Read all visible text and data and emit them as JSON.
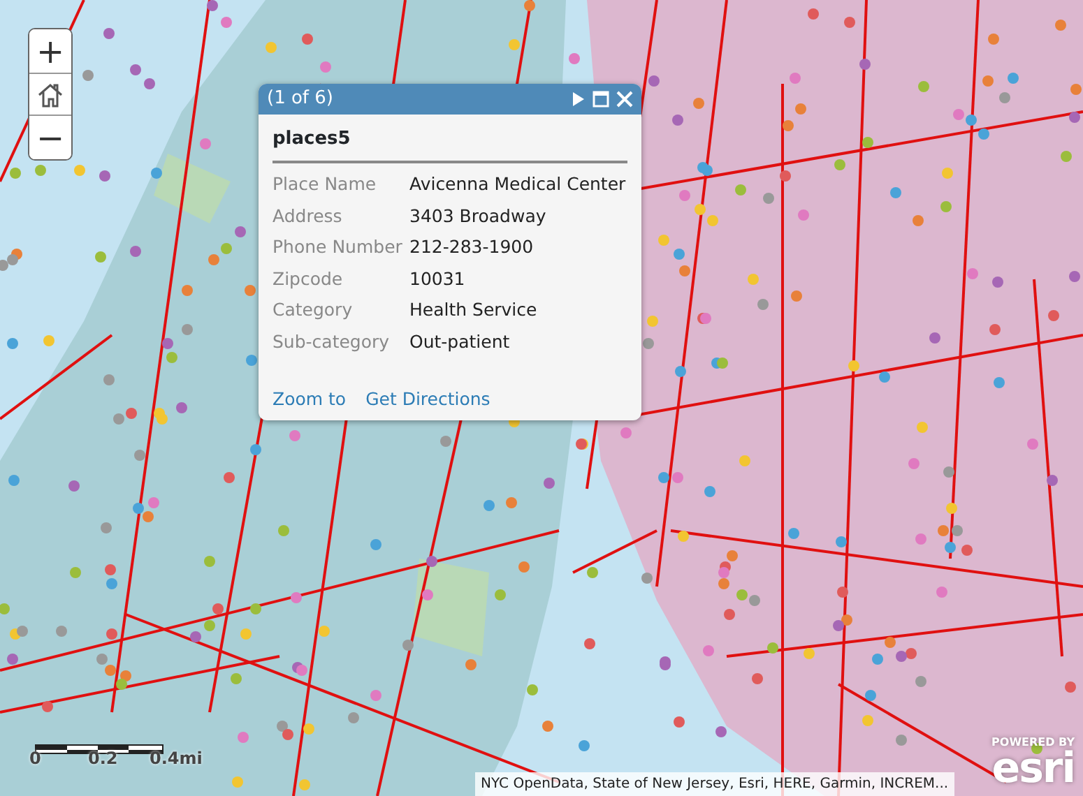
{
  "zoom_controls": {
    "zoom_in": "+",
    "zoom_out": "−"
  },
  "popup": {
    "counter": "(1 of 6)",
    "title": "places5",
    "fields": [
      {
        "label": "Place Name",
        "value": "Avicenna Medical Center"
      },
      {
        "label": "Address",
        "value": "3403 Broadway"
      },
      {
        "label": "Phone Number",
        "value": "212-283-1900"
      },
      {
        "label": "Zipcode",
        "value": "10031"
      },
      {
        "label": "Category",
        "value": "Health Service"
      },
      {
        "label": "Sub-category",
        "value": "Out-patient"
      }
    ],
    "actions": [
      "Zoom to",
      "Get Directions"
    ]
  },
  "scale_bar": {
    "labels": [
      "0",
      "0.2",
      "0.4mi"
    ]
  },
  "attribution": "NYC OpenData, State of New Jersey, Esri, HERE, Garmin, INCREM...",
  "logo": {
    "tagline": "POWERED BY",
    "name": "esri"
  }
}
